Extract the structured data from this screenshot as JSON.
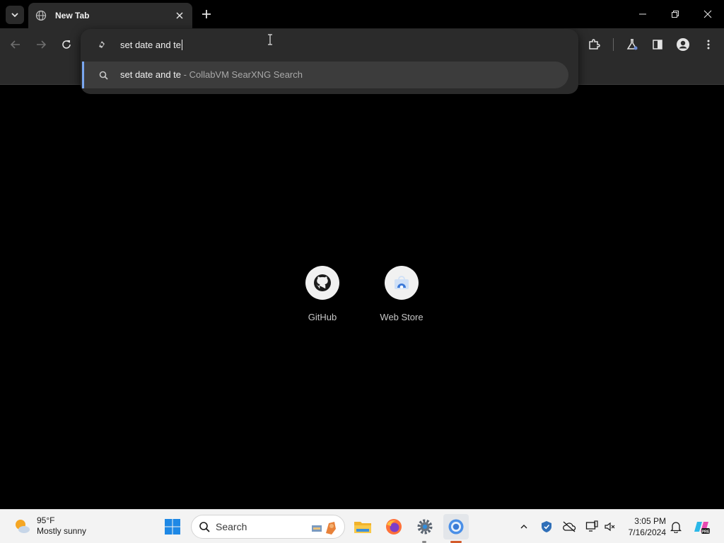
{
  "browser": {
    "tab": {
      "title": "New Tab"
    },
    "omnibox": {
      "input_value": "set date and te",
      "suggestion": {
        "query": "set date and te",
        "separator": " - ",
        "engine": "CollabVM SearXNG Search"
      }
    },
    "shortcuts": [
      {
        "label": "GitHub",
        "icon": "github-icon"
      },
      {
        "label": "Web Store",
        "icon": "web-store-icon"
      }
    ]
  },
  "taskbar": {
    "weather": {
      "temp": "95°F",
      "condition": "Mostly sunny"
    },
    "search": {
      "label": "Search"
    },
    "clock": {
      "time": "3:05 PM",
      "date": "7/16/2024"
    },
    "apps": [
      "start-icon",
      "search-icon",
      "file-explorer-icon",
      "firefox-icon",
      "settings-icon",
      "chrome-icon"
    ]
  },
  "colors": {
    "accent": "#7aa7f0",
    "toolbar_bg": "#2b2b2b",
    "page_bg": "#000000",
    "taskbar_bg": "#f3f3f3"
  }
}
